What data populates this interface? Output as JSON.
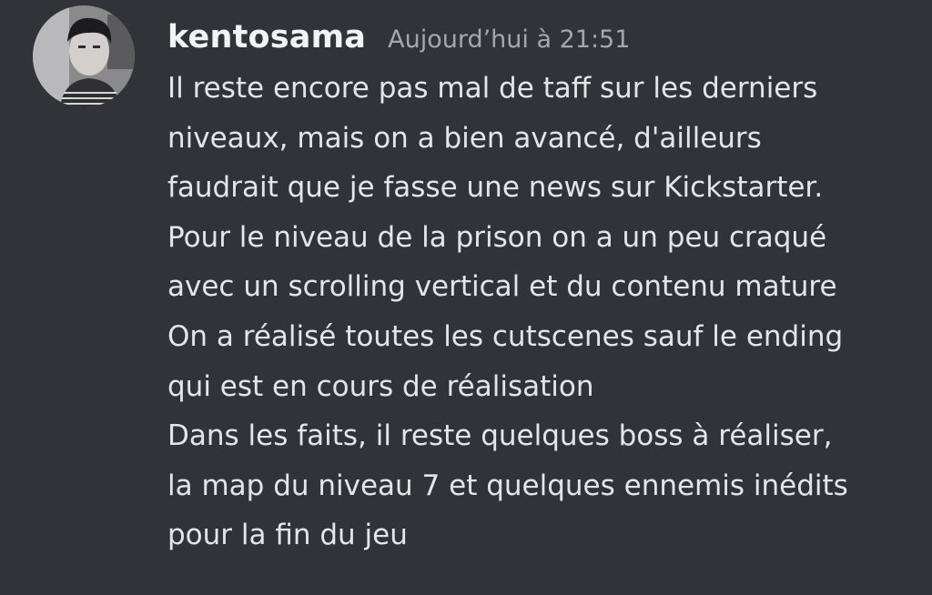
{
  "message": {
    "author": {
      "username": "kentosama",
      "avatar_icon": "user-photo-avatar"
    },
    "timestamp": "Aujourd’hui à 21:51",
    "lines": [
      "Il reste encore pas mal de taff sur les derniers",
      "niveaux, mais on a bien avancé, d'ailleurs",
      "faudrait que je fasse une news sur Kickstarter.",
      "Pour le niveau de la prison on a un peu craqué",
      "avec un scrolling vertical et du contenu mature",
      "On a réalisé toutes les cutscenes sauf le ending",
      "qui est en cours de réalisation",
      "Dans les faits, il reste quelques boss à réaliser,",
      "la map du niveau 7 et quelques ennemis inédits",
      "pour la fin du jeu"
    ]
  },
  "colors": {
    "background": "#313338",
    "username": "#f2f3f5",
    "timestamp": "#a4a7ad",
    "text": "#e3e5e8"
  }
}
